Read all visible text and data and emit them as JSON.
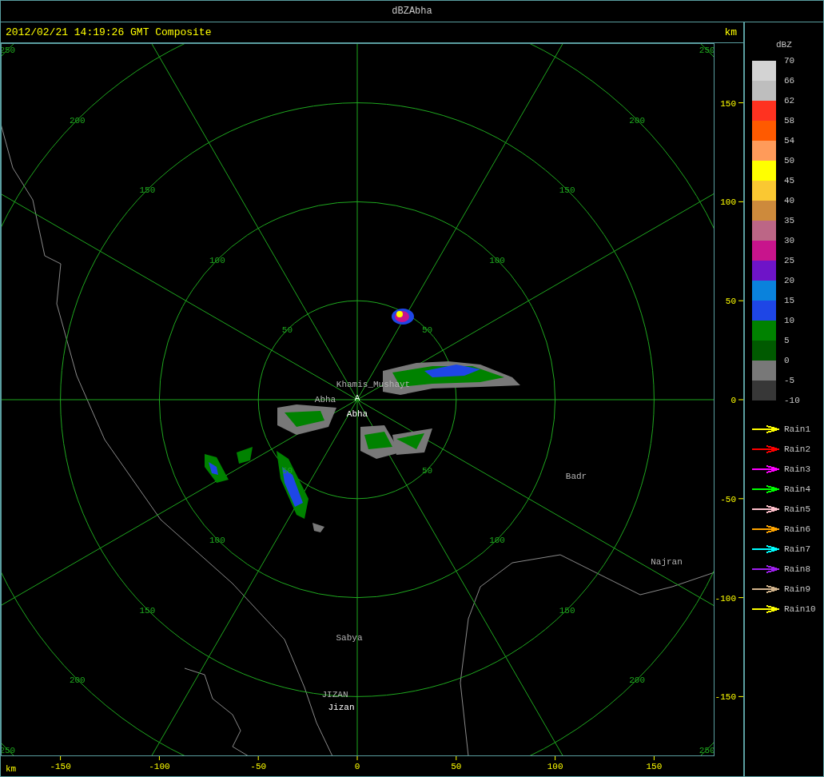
{
  "window": {
    "title": "dBZAbha"
  },
  "header": {
    "timestamp": "2012/02/21 14:19:26 GMT Composite",
    "unit": "km"
  },
  "plot": {
    "ring_labels": [
      [
        "50",
        "100",
        "150",
        "200",
        "250"
      ],
      [
        "50",
        "100",
        "150",
        "200",
        "250"
      ],
      [
        "50",
        "100",
        "150",
        "200",
        "250"
      ],
      [
        "50",
        "100",
        "150",
        "200",
        "250"
      ]
    ],
    "places": [
      {
        "name": "Khamis_Mushayt",
        "kind": "town"
      },
      {
        "name": "Abha",
        "kind": "town"
      },
      {
        "name": "A",
        "kind": "site"
      },
      {
        "name": "Abha",
        "kind": "radar"
      },
      {
        "name": "Badr",
        "kind": "town"
      },
      {
        "name": "Najran",
        "kind": "town"
      },
      {
        "name": "Sabya",
        "kind": "town"
      },
      {
        "name": "JIZAN",
        "kind": "town"
      },
      {
        "name": "Jizan",
        "kind": "radar"
      }
    ]
  },
  "y_axis": {
    "ticks": [
      "150",
      "100",
      "50",
      "0",
      "-50",
      "-100",
      "-150"
    ]
  },
  "x_axis": {
    "unit": "km",
    "ticks": [
      "-150",
      "-100",
      "-50",
      "0",
      "50",
      "100",
      "150"
    ]
  },
  "legend": {
    "title": "dBZ",
    "bins": [
      {
        "color": "#d3d3d3"
      },
      {
        "color": "#bebebe"
      },
      {
        "color": "#ff3220"
      },
      {
        "color": "#ff5a00"
      },
      {
        "color": "#ff9b5a"
      },
      {
        "color": "#ffff00"
      },
      {
        "color": "#fac832"
      },
      {
        "color": "#cd8a3c"
      },
      {
        "color": "#bc6686"
      },
      {
        "color": "#c8148c"
      },
      {
        "color": "#6e14c8"
      },
      {
        "color": "#0a82dc"
      },
      {
        "color": "#1e46e6"
      },
      {
        "color": "#008200"
      },
      {
        "color": "#005a00"
      },
      {
        "color": "#787878"
      },
      {
        "color": "#373737"
      }
    ],
    "labels": [
      "70",
      "66",
      "62",
      "58",
      "54",
      "50",
      "45",
      "40",
      "35",
      "30",
      "25",
      "20",
      "15",
      "10",
      "5",
      "0",
      "-5",
      "-10"
    ],
    "tracks": [
      {
        "name": "Rain1",
        "color": "#ffff00"
      },
      {
        "name": "Rain2",
        "color": "#ff0000"
      },
      {
        "name": "Rain3",
        "color": "#ff00ff"
      },
      {
        "name": "Rain4",
        "color": "#00ff00"
      },
      {
        "name": "Rain5",
        "color": "#ffc0cb"
      },
      {
        "name": "Rain6",
        "color": "#ffa500"
      },
      {
        "name": "Rain7",
        "color": "#00ffff"
      },
      {
        "name": "Rain8",
        "color": "#a020f0"
      },
      {
        "name": "Rain9",
        "color": "#d2b48c"
      },
      {
        "name": "Rain10",
        "color": "#ffff00"
      }
    ]
  }
}
